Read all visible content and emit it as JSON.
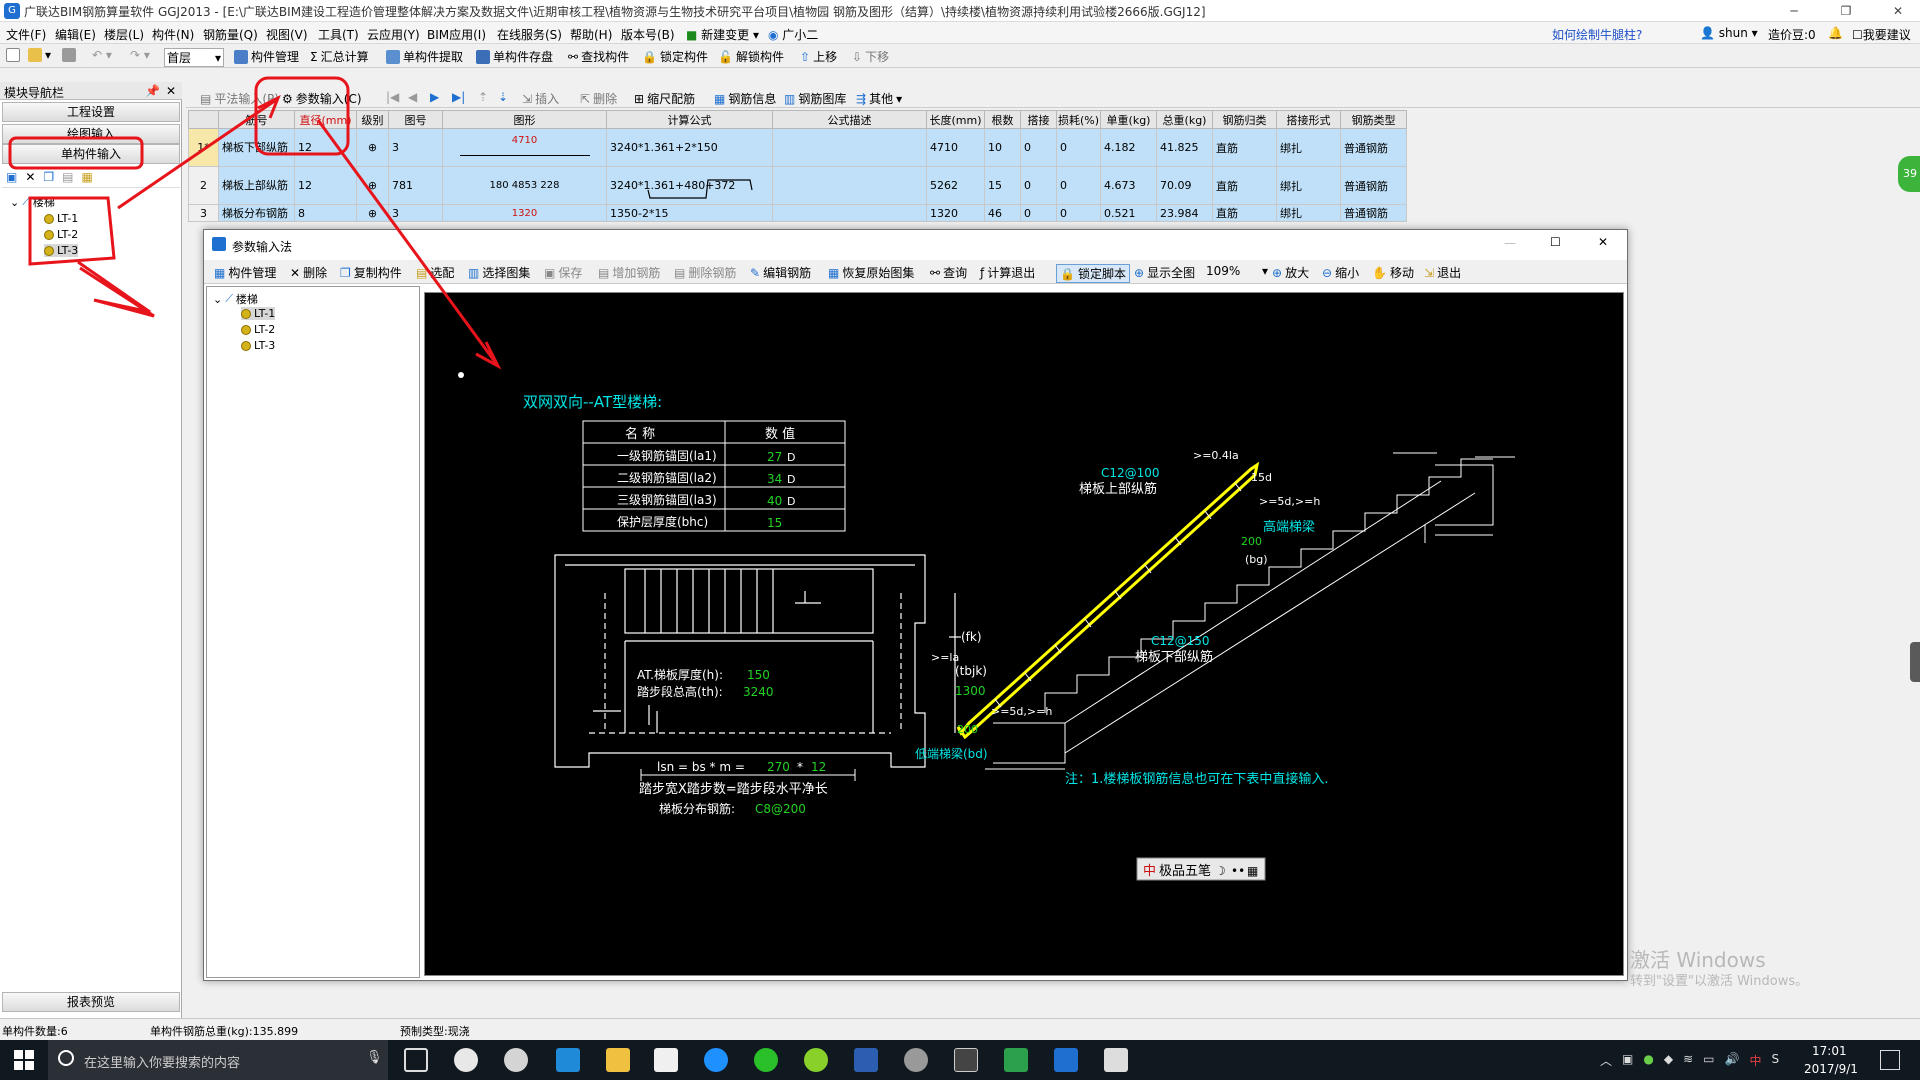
{
  "window": {
    "title": "广联达BIM钢筋算量软件 GGJ2013 - [E:\\广联达BIM建设工程造价管理整体解决方案及数据文件\\近期审核工程\\植物资源与生物技术研究平台项目\\植物园 钢筋及图形（结算）\\持续楼\\植物资源持续利用试验楼2666版.GGJ12]",
    "controls": [
      "─",
      "❐",
      "✕"
    ]
  },
  "menu": {
    "items": [
      "文件(F)",
      "编辑(E)",
      "楼层(L)",
      "构件(N)",
      "钢筋量(Q)",
      "视图(V)",
      "工具(T)",
      "云应用(Y)",
      "BIM应用(I)",
      "在线服务(S)",
      "帮助(H)",
      "版本号(B)",
      "新建变更",
      "广小二"
    ],
    "help_link": "如何绘制牛腿柱?",
    "user": "shun",
    "beans": "造价豆:0",
    "suggest": "我要建议"
  },
  "toolbar1": {
    "floor": "首层",
    "items": [
      "构件管理",
      "汇总计算",
      "单构件提取",
      "单构件存盘",
      "查找构件",
      "锁定构件",
      "解锁构件",
      "上移",
      "下移"
    ]
  },
  "leftnav": {
    "header": "模块导航栏",
    "buttons": [
      "工程设置",
      "绘图输入",
      "单构件输入"
    ],
    "tree_root": "楼梯",
    "tree_items": [
      "LT-1",
      "LT-2",
      "LT-3"
    ],
    "footer": "报表预览"
  },
  "toolbar2": {
    "items": [
      "平法输入(P)",
      "参数输入(C)",
      "插入",
      "删除",
      "缩尺配筋",
      "钢筋信息",
      "钢筋图库",
      "其他"
    ]
  },
  "grid": {
    "headers": [
      "",
      "筋号",
      "直径(mm)",
      "级别",
      "图号",
      "图形",
      "计算公式",
      "公式描述",
      "长度(mm)",
      "根数",
      "搭接",
      "损耗(%)",
      "单重(kg)",
      "总重(kg)",
      "钢筋归类",
      "搭接形式",
      "钢筋类型"
    ],
    "rows": [
      {
        "idx": "1*",
        "name": "梯板下部纵筋",
        "dia": "12",
        "grade": "⊕",
        "fig": "3",
        "shape": "4710",
        "formula": "3240*1.361+2*150",
        "desc": "",
        "len": "4710",
        "count": "10",
        "lap": "0",
        "loss": "0",
        "unit": "4.182",
        "total": "41.825",
        "cat": "直筋",
        "laptype": "绑扎",
        "type": "普通钢筋"
      },
      {
        "idx": "2",
        "name": "梯板上部纵筋",
        "dia": "12",
        "grade": "⊕",
        "fig": "781",
        "shape": "180 4853 228",
        "formula": "3240*1.361+480+372",
        "desc": "",
        "len": "5262",
        "count": "15",
        "lap": "0",
        "loss": "0",
        "unit": "4.673",
        "total": "70.09",
        "cat": "直筋",
        "laptype": "绑扎",
        "type": "普通钢筋"
      },
      {
        "idx": "3",
        "name": "梯板分布钢筋",
        "dia": "8",
        "grade": "⊕",
        "fig": "3",
        "shape": "1320",
        "formula": "1350-2*15",
        "desc": "",
        "len": "1320",
        "count": "46",
        "lap": "0",
        "loss": "0",
        "unit": "0.521",
        "total": "23.984",
        "cat": "直筋",
        "laptype": "绑扎",
        "type": "普通钢筋"
      }
    ]
  },
  "dialog": {
    "title": "参数输入法",
    "toolbar": [
      "构件管理",
      "删除",
      "复制构件",
      "选配",
      "选择图集",
      "保存",
      "增加钢筋",
      "删除钢筋",
      "编辑钢筋",
      "恢复原始图集",
      "查询",
      "计算退出",
      "锁定脚本",
      "显示全图",
      "109%",
      "放大",
      "缩小",
      "移动",
      "退出"
    ],
    "tree_root": "楼梯",
    "tree_items": [
      "LT-1",
      "LT-2",
      "LT-3"
    ]
  },
  "drawing": {
    "heading": "双网双向--AT型楼梯:",
    "table_head": [
      "名 称",
      "数 值"
    ],
    "table_rows": [
      {
        "name": "一级钢筋锚固(la1)",
        "val": "27",
        "unit": "D"
      },
      {
        "name": "二级钢筋锚固(la2)",
        "val": "34",
        "unit": "D"
      },
      {
        "name": "三级钢筋锚固(la3)",
        "val": "40",
        "unit": "D"
      },
      {
        "name": "保护层厚度(bhc)",
        "val": "15",
        "unit": ""
      }
    ],
    "plan_thick_label": "AT.梯板厚度(h):",
    "plan_thick_val": "150",
    "plan_height_label": "踏步段总高(th):",
    "plan_height_val": "3240",
    "fk": "(fk)",
    "tbjk": "(tbjk)",
    "tbjk_val": "1300",
    "lsn_label": "lsn = bs * m =",
    "lsn_bs": "270",
    "lsn_star": "*",
    "lsn_m": "12",
    "formula_line": "踏步宽X踏步数=踏步段水平净长",
    "dist_label": "梯板分布钢筋:",
    "dist_val": "C8@200",
    "top_bar_val": "C12@100",
    "top_bar_label": "梯板上部纵筋",
    "bot_bar_val": "C12@150",
    "bot_bar_label": "梯板下部纵筋",
    "high_beam": "高端梯梁",
    "low_beam": "低端梯梁(bd)",
    "dim_04la": ">=0.4la",
    "dim_15d": "15d",
    "dim_5d_h": ">=5d,>=h",
    "dim_la": ">=la",
    "dim_200a": "200",
    "dim_bg": "(bg)",
    "dim_200b": "200",
    "dim_5d_h2": ">=5d,>=h",
    "note": "注：1.楼梯板钢筋信息也可在下表中直接输入.",
    "ime": "极品五笔"
  },
  "watermark": {
    "line1": "激活 Windows",
    "line2": "转到\"设置\"以激活 Windows。"
  },
  "status": {
    "count": "单构件数量:6",
    "weight": "单构件钢筋总重(kg):135.899",
    "prefab": "预制类型:现浇"
  },
  "taskbar": {
    "search_placeholder": "在这里输入你要搜索的内容",
    "time": "17:01",
    "date": "2017/9/1"
  },
  "colors": {
    "annotation_red": "#e8141c",
    "cad_cyan": "#00e5e5",
    "cad_green": "#22d322",
    "cad_yellow": "#ffff00",
    "selection_blue": "#bfe0f8"
  }
}
